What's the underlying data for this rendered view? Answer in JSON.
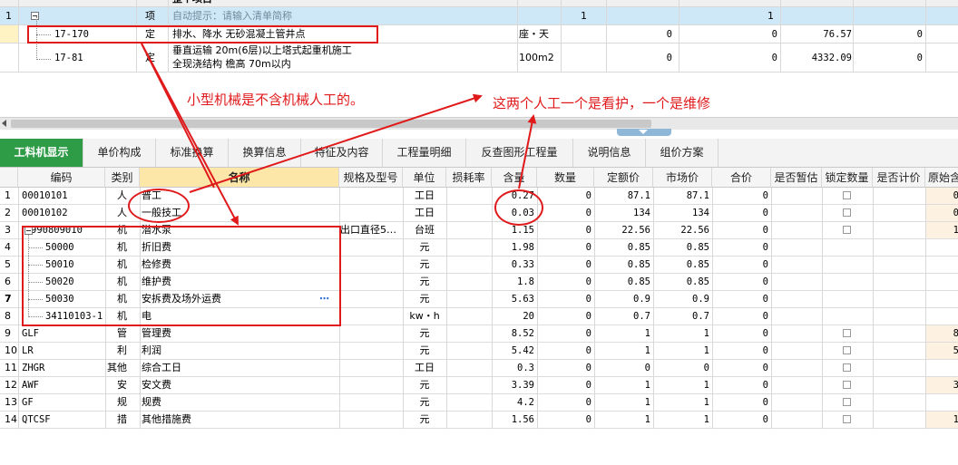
{
  "top_grid": {
    "header_fragment": "整个项目",
    "rows": [
      {
        "index": "1",
        "code": "",
        "type": "项",
        "name": "自动提示：请输入清单简称",
        "unit": "",
        "v1": "1",
        "v2": "1",
        "v3": "",
        "v4": ""
      },
      {
        "index": "",
        "code": "17-170",
        "type": "定",
        "name": "排水、降水 无砂混凝土管井点",
        "unit": "座・天",
        "v1": "0",
        "v2": "0",
        "v3": "76.57",
        "v4": "0"
      },
      {
        "index": "",
        "code": "17-81",
        "type": "定",
        "name_line1": "垂直运输 20m(6层)以上塔式起重机施工",
        "name_line2": "全现浇结构 檐高 70m以内",
        "unit": "100m2",
        "v1": "0",
        "v2": "0",
        "v3": "4332.09",
        "v4": "0"
      }
    ]
  },
  "annotations": {
    "note_left": "小型机械是不含机械人工的。",
    "note_right": "这两个人工一个是看护，一个是维修"
  },
  "tabs": [
    "工料机显示",
    "单价构成",
    "标准换算",
    "换算信息",
    "特征及内容",
    "工程量明细",
    "反查图形工程量",
    "说明信息",
    "组价方案"
  ],
  "columns": [
    "编码",
    "类别",
    "名称",
    "规格及型号",
    "单位",
    "损耗率",
    "含量",
    "数量",
    "定额价",
    "市场价",
    "合价",
    "是否暂估",
    "锁定数量",
    "是否计价",
    "原始含"
  ],
  "rows": [
    {
      "no": "1",
      "code": "00010101",
      "cat": "人",
      "name": "普工",
      "spec": "",
      "unit": "工日",
      "loss": "",
      "content": "0.27",
      "qty": "0",
      "quota": "87.1",
      "market": "87.1",
      "total": "0",
      "est": false,
      "lock": true,
      "price": false,
      "orig": "0"
    },
    {
      "no": "2",
      "code": "00010102",
      "cat": "人",
      "name": "一般技工",
      "spec": "",
      "unit": "工日",
      "loss": "",
      "content": "0.03",
      "qty": "0",
      "quota": "134",
      "market": "134",
      "total": "0",
      "est": false,
      "lock": true,
      "price": false,
      "orig": "0"
    },
    {
      "no": "3",
      "code": "990809010",
      "cat": "机",
      "name": "潜水泵",
      "spec": "出口直径5…",
      "unit": "台班",
      "loss": "",
      "content": "1.15",
      "qty": "0",
      "quota": "22.56",
      "market": "22.56",
      "total": "0",
      "est": false,
      "lock": true,
      "price": false,
      "orig": "1"
    },
    {
      "no": "4",
      "code": "50000",
      "cat": "机",
      "name": "折旧费",
      "spec": "",
      "unit": "元",
      "loss": "",
      "content": "1.98",
      "qty": "0",
      "quota": "0.85",
      "market": "0.85",
      "total": "0",
      "est": false,
      "lock": false,
      "price": false,
      "orig": ""
    },
    {
      "no": "5",
      "code": "50010",
      "cat": "机",
      "name": "检修费",
      "spec": "",
      "unit": "元",
      "loss": "",
      "content": "0.33",
      "qty": "0",
      "quota": "0.85",
      "market": "0.85",
      "total": "0",
      "est": false,
      "lock": false,
      "price": false,
      "orig": ""
    },
    {
      "no": "6",
      "code": "50020",
      "cat": "机",
      "name": "维护费",
      "spec": "",
      "unit": "元",
      "loss": "",
      "content": "1.8",
      "qty": "0",
      "quota": "0.85",
      "market": "0.85",
      "total": "0",
      "est": false,
      "lock": false,
      "price": false,
      "orig": ""
    },
    {
      "no": "7",
      "code": "50030",
      "cat": "机",
      "name": "安拆费及场外运费",
      "spec": "",
      "unit": "元",
      "loss": "",
      "content": "5.63",
      "qty": "0",
      "quota": "0.9",
      "market": "0.9",
      "total": "0",
      "est": false,
      "lock": false,
      "price": false,
      "orig": ""
    },
    {
      "no": "8",
      "code": "34110103-1",
      "cat": "机",
      "name": "电",
      "spec": "",
      "unit": "kw・h",
      "loss": "",
      "content": "20",
      "qty": "0",
      "quota": "0.7",
      "market": "0.7",
      "total": "0",
      "est": false,
      "lock": false,
      "price": false,
      "orig": ""
    },
    {
      "no": "9",
      "code": "GLF",
      "cat": "管",
      "name": "管理费",
      "spec": "",
      "unit": "元",
      "loss": "",
      "content": "8.52",
      "qty": "0",
      "quota": "1",
      "market": "1",
      "total": "0",
      "est": false,
      "lock": true,
      "price": false,
      "orig": "8"
    },
    {
      "no": "10",
      "code": "LR",
      "cat": "利",
      "name": "利润",
      "spec": "",
      "unit": "元",
      "loss": "",
      "content": "5.42",
      "qty": "0",
      "quota": "1",
      "market": "1",
      "total": "0",
      "est": false,
      "lock": true,
      "price": false,
      "orig": "5"
    },
    {
      "no": "11",
      "code": "ZHGR",
      "cat": "其他",
      "name": "综合工日",
      "spec": "",
      "unit": "工日",
      "loss": "",
      "content": "0.3",
      "qty": "0",
      "quota": "0",
      "market": "0",
      "total": "0",
      "est": false,
      "lock": true,
      "price": false,
      "orig": ""
    },
    {
      "no": "12",
      "code": "AWF",
      "cat": "安",
      "name": "安文费",
      "spec": "",
      "unit": "元",
      "loss": "",
      "content": "3.39",
      "qty": "0",
      "quota": "1",
      "market": "1",
      "total": "0",
      "est": false,
      "lock": true,
      "price": false,
      "orig": "3"
    },
    {
      "no": "13",
      "code": "GF",
      "cat": "规",
      "name": "规费",
      "spec": "",
      "unit": "元",
      "loss": "",
      "content": "4.2",
      "qty": "0",
      "quota": "1",
      "market": "1",
      "total": "0",
      "est": false,
      "lock": true,
      "price": false,
      "orig": ""
    },
    {
      "no": "14",
      "code": "QTCSF",
      "cat": "措",
      "name": "其他措施费",
      "spec": "",
      "unit": "元",
      "loss": "",
      "content": "1.56",
      "qty": "0",
      "quota": "1",
      "market": "1",
      "total": "0",
      "est": false,
      "lock": true,
      "price": false,
      "orig": "1"
    }
  ],
  "colors": {
    "accent_green": "#2e9b47",
    "annotation_red": "#e0191b",
    "selected_row": "#cfe8f7"
  }
}
